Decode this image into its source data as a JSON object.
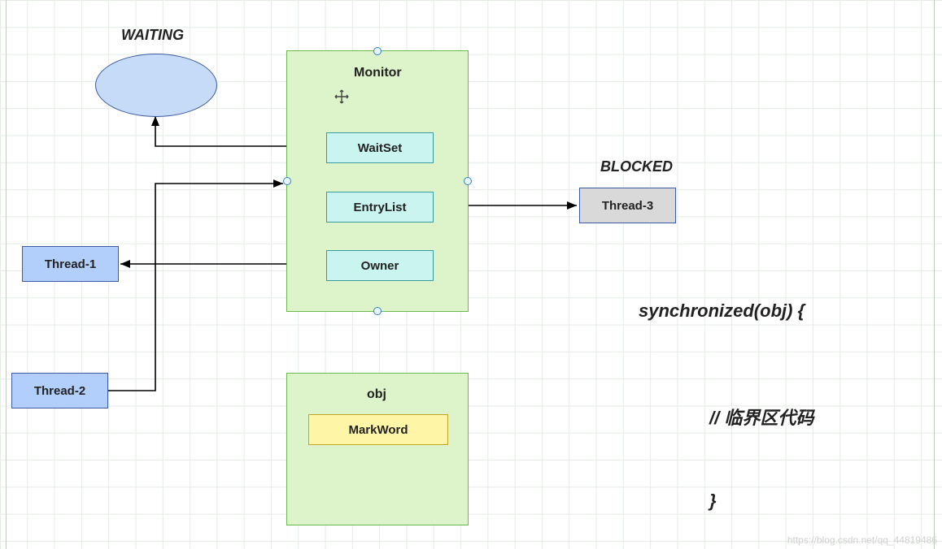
{
  "labels": {
    "waiting": "WAITING",
    "blocked": "BLOCKED",
    "monitor": "Monitor",
    "waitset": "WaitSet",
    "entrylist": "EntryList",
    "owner": "Owner",
    "obj": "obj",
    "markword": "MarkWord"
  },
  "nodes": {
    "thread1": "Thread-1",
    "thread2": "Thread-2",
    "thread3": "Thread-3"
  },
  "code": {
    "line1": "synchronized(obj) {",
    "line2": "// 临界区代码",
    "line3": "}"
  },
  "watermark": "https://blog.csdn.net/qq_44819486",
  "colors": {
    "grid": "#e4ece4",
    "greenPanel": "#ddf3c9",
    "greenBorder": "#6bb84d",
    "blueFill": "#b2cffb",
    "blueBorder": "#3b5aa0",
    "tealFill": "#c9f4ef",
    "tealBorder": "#3b9a9c",
    "yellowFill": "#fff5a6",
    "yellowBorder": "#c9a227",
    "greyFill": "#d9d9d9"
  }
}
